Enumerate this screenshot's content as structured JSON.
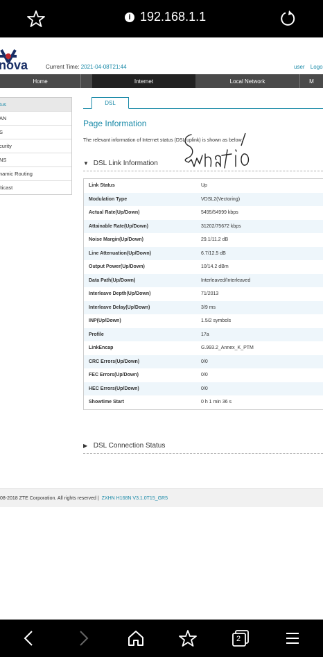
{
  "browser": {
    "url": "192.168.1.1",
    "tab_count": "2"
  },
  "header": {
    "logo_text": "nova",
    "current_time_label": "Current Time:",
    "current_time_value": "2021-04-08T21:44",
    "user_label": "user",
    "logout_label": "Logou"
  },
  "nav": {
    "items": [
      {
        "label": "Home"
      },
      {
        "label": "Internet"
      },
      {
        "label": "Local Network"
      },
      {
        "label": "M"
      }
    ]
  },
  "sidebar": {
    "items": [
      {
        "label": "tus"
      },
      {
        "label": "AN"
      },
      {
        "label": "S"
      },
      {
        "label": "curity"
      },
      {
        "label": "NS"
      },
      {
        "label": "namic Routing"
      },
      {
        "label": "lticast"
      }
    ]
  },
  "tab": {
    "label": "DSL"
  },
  "page": {
    "title": "Page Information",
    "description": "The relevant information of Internet status (DSL uplink) is shown as below.",
    "section1": "DSL Link Information",
    "section2": "DSL Connection Status"
  },
  "dsl_table": [
    {
      "key": "Link Status",
      "value": "Up"
    },
    {
      "key": "Modulation Type",
      "value": "VDSL2(Vectoring)"
    },
    {
      "key": "Actual Rate(Up/Down)",
      "value": "5495/54999 kbps"
    },
    {
      "key": "Attainable Rate(Up/Down)",
      "value": "31202/75672 kbps"
    },
    {
      "key": "Noise Margin(Up/Down)",
      "value": "29.1/11.2 dB"
    },
    {
      "key": "Line Attenuation(Up/Down)",
      "value": "6.7/12.5 dB"
    },
    {
      "key": "Output Power(Up/Down)",
      "value": "10/14.2 dBm"
    },
    {
      "key": "Data Path(Up/Down)",
      "value": "Interleaved/Interleaved"
    },
    {
      "key": "Interleave Depth(Up/Down)",
      "value": "71/2013"
    },
    {
      "key": "Interleave Delay(Up/Down)",
      "value": "3/9 ms"
    },
    {
      "key": "INP(Up/Down)",
      "value": "1.5/2 symbols"
    },
    {
      "key": "Profile",
      "value": "17a"
    },
    {
      "key": "LinkEncap",
      "value": "G.993.2_Annex_K_PTM"
    },
    {
      "key": "CRC Errors(Up/Down)",
      "value": "0/0"
    },
    {
      "key": "FEC Errors(Up/Down)",
      "value": "0/0"
    },
    {
      "key": "HEC Errors(Up/Down)",
      "value": "0/0"
    },
    {
      "key": "Showtime Start",
      "value": "0 h 1 min 36 s"
    }
  ],
  "footer": {
    "copyright": "08-2018 ZTE Corporation. All rights reserved  |",
    "version": "ZXHN H168N V3.1.0T15_GR5"
  },
  "handwriting": "Swhatio",
  "colors": {
    "accent": "#1a8aa8",
    "nav_bg": "#4a4a4a",
    "nav_active": "#222222",
    "browser_bar": "#000000"
  }
}
